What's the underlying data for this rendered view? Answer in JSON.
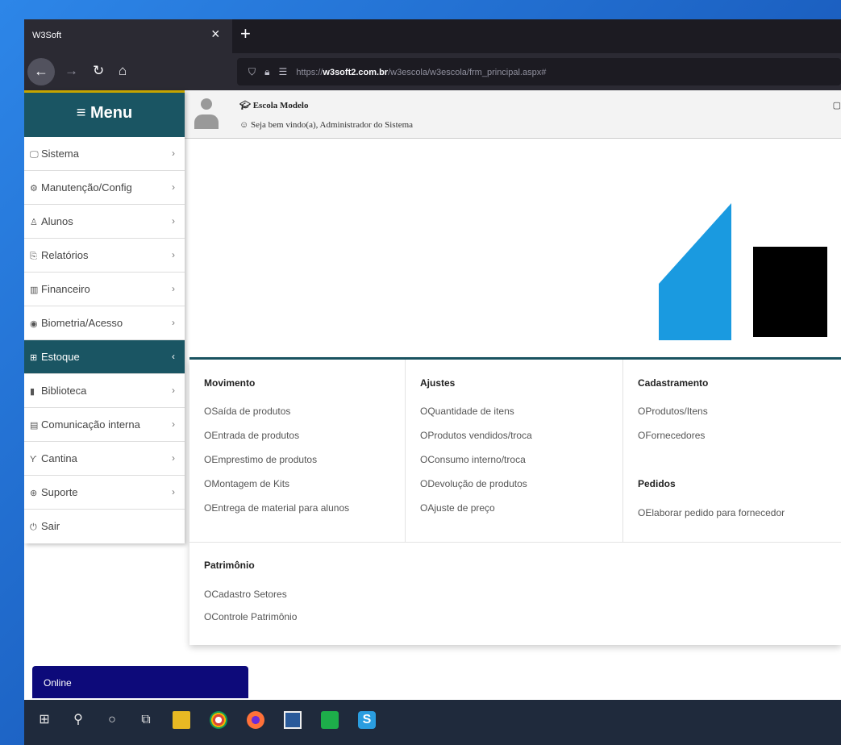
{
  "browser": {
    "tab_title": "W3Soft",
    "tab_close": "×",
    "new_tab": "+",
    "url_prefix": "https://",
    "url_host": "w3soft2.com.br",
    "url_path": "/w3escola/w3escola/frm_principal.aspx#"
  },
  "sidebar": {
    "title": "≡ Menu",
    "items": [
      {
        "label": "Sistema",
        "icon": "monitor-icon",
        "glyph": "🖵"
      },
      {
        "label": "Manutenção/Config",
        "icon": "gear-icon",
        "glyph": "⚙"
      },
      {
        "label": "Alunos",
        "icon": "user-icon",
        "glyph": "♙"
      },
      {
        "label": "Relatórios",
        "icon": "copy-icon",
        "glyph": "⎘"
      },
      {
        "label": "Financeiro",
        "icon": "money-icon",
        "glyph": "▥"
      },
      {
        "label": "Biometria/Acesso",
        "icon": "fingerprint-icon",
        "glyph": "◉"
      },
      {
        "label": "Estoque",
        "icon": "gift-icon",
        "glyph": "⊞"
      },
      {
        "label": "Biblioteca",
        "icon": "books-icon",
        "glyph": "▮"
      },
      {
        "label": "Comunicação interna",
        "icon": "chat-icon",
        "glyph": "▤"
      },
      {
        "label": "Cantina",
        "icon": "cutlery-icon",
        "glyph": "ϒ"
      },
      {
        "label": "Suporte",
        "icon": "support-icon",
        "glyph": "⊛"
      },
      {
        "label": "Sair",
        "icon": "power-icon",
        "glyph": "⏻"
      }
    ]
  },
  "header": {
    "school": "Escola Modelo",
    "welcome": "Seja bem vindo(a), Administrador do Sistema"
  },
  "mega_menu": {
    "movimento": {
      "title": "Movimento",
      "links": [
        "Saída de produtos",
        "Entrada de produtos",
        "Emprestimo de produtos",
        "Montagem de Kits",
        "Entrega de material para alunos"
      ]
    },
    "ajustes": {
      "title": "Ajustes",
      "links": [
        "Quantidade de itens",
        "Produtos vendidos/troca",
        "Consumo interno/troca",
        "Devolução de produtos",
        "Ajuste de preço"
      ]
    },
    "cadastramento": {
      "title": "Cadastramento",
      "links": [
        "Produtos/Itens",
        "Fornecedores"
      ]
    },
    "pedidos": {
      "title": "Pedidos",
      "links": [
        "Elaborar pedido para fornecedor"
      ]
    },
    "patrimonio": {
      "title": "Patrimônio",
      "links": [
        "Cadastro Setores",
        "Controle Patrimônio"
      ]
    }
  },
  "status": {
    "online": "Online"
  },
  "colors": {
    "teal": "#1a5563",
    "logo_blue": "#1a9ae0",
    "online_bg": "#0d0a7a"
  }
}
